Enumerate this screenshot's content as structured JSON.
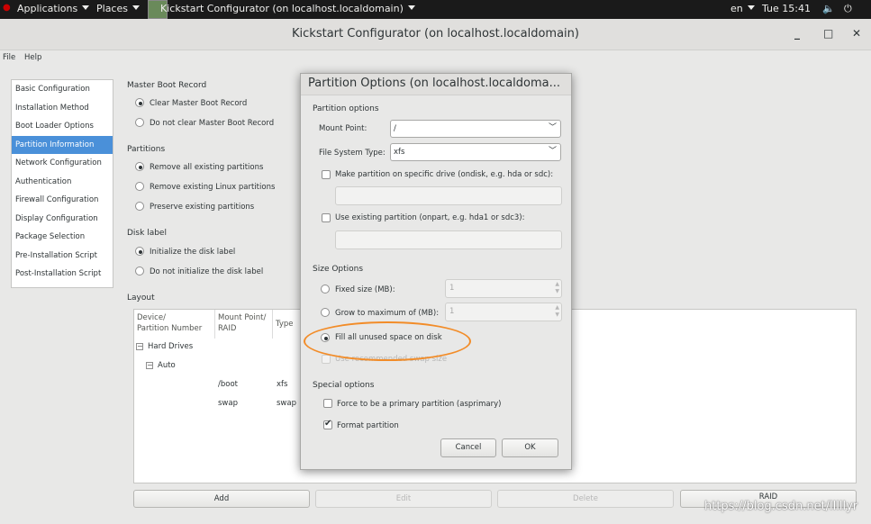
{
  "topbar": {
    "applications": "Applications",
    "places": "Places",
    "window_menu": "Kickstart Configurator (on localhost.localdomain)",
    "lang": "en",
    "clock": "Tue 15:41"
  },
  "window": {
    "title": "Kickstart Configurator (on localhost.localdomain)",
    "minimize": "_",
    "maximize": "□",
    "close": "✕"
  },
  "menubar": {
    "file": "File",
    "help": "Help"
  },
  "sidebar": {
    "items": [
      "Basic Configuration",
      "Installation Method",
      "Boot Loader Options",
      "Partition Information",
      "Network Configuration",
      "Authentication",
      "Firewall Configuration",
      "Display Configuration",
      "Package Selection",
      "Pre-Installation Script",
      "Post-Installation Script"
    ],
    "selected_index": 3
  },
  "main": {
    "mbr": {
      "heading": "Master Boot Record",
      "opt1": "Clear Master Boot Record",
      "opt2": "Do not clear Master Boot Record"
    },
    "partitions": {
      "heading": "Partitions",
      "opt1": "Remove all existing partitions",
      "opt2": "Remove existing Linux partitions",
      "opt3": "Preserve existing partitions"
    },
    "disklabel": {
      "heading": "Disk label",
      "opt1": "Initialize the disk label",
      "opt2": "Do not initialize the disk label"
    },
    "layout": {
      "heading": "Layout",
      "col_device": "Device/\nPartition Number",
      "col_mount": "Mount Point/\nRAID",
      "col_type": "Type",
      "hard_drives": "Hard Drives",
      "auto": "Auto",
      "rows": [
        {
          "mount": "/boot",
          "type": "xfs"
        },
        {
          "mount": "swap",
          "type": "swap"
        }
      ]
    },
    "buttons": {
      "add": "Add",
      "edit": "Edit",
      "delete": "Delete",
      "raid": "RAID"
    }
  },
  "dialog": {
    "title": "Partition Options (on localhost.localdoma...",
    "partition_options": {
      "heading": "Partition options",
      "mount_label": "Mount Point:",
      "mount_value": "/",
      "fs_label": "File System Type:",
      "fs_value": "xfs",
      "ondisk_label": "Make partition on specific drive (ondisk, e.g. hda or sdc):",
      "onpart_label": "Use existing partition (onpart, e.g. hda1 or sdc3):"
    },
    "size_options": {
      "heading": "Size Options",
      "fixed_label": "Fixed size (MB):",
      "fixed_value": "1",
      "grow_label": "Grow to maximum of (MB):",
      "grow_value": "1",
      "fill_label": "Fill all unused space on disk",
      "swap_label": "Use recommended swap size"
    },
    "special_options": {
      "heading": "Special options",
      "primary_label": "Force to be a primary partition (asprimary)",
      "format_label": "Format partition"
    },
    "cancel": "Cancel",
    "ok": "OK"
  },
  "watermark": "https://blog.csdn.net/lllllyr",
  "colors": {
    "selection": "#4a90d9",
    "annotation": "#f28c28",
    "topbar": "#1a1a1a"
  }
}
